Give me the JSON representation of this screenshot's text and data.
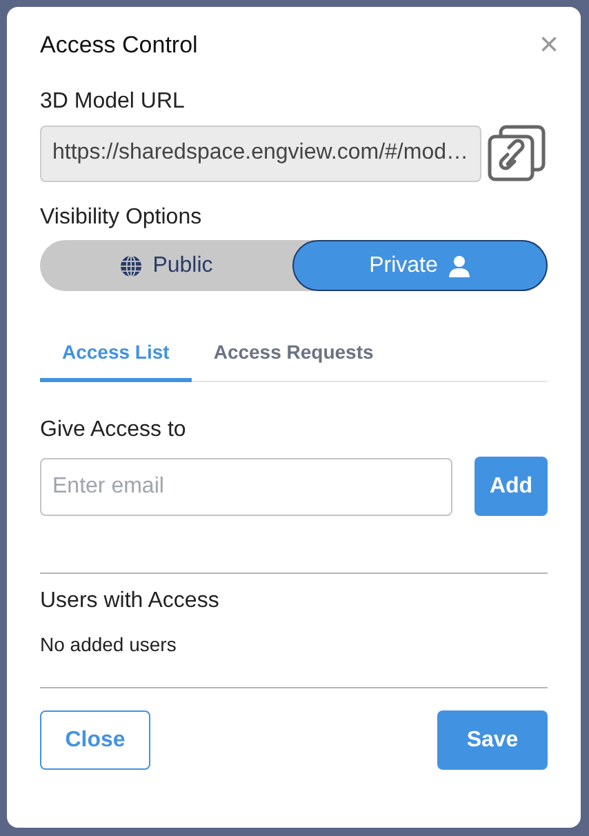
{
  "dialog": {
    "title": "Access Control",
    "close_icon": "×"
  },
  "url_field": {
    "label": "3D Model URL",
    "value": "https://sharedspace.engview.com/#/mod…"
  },
  "visibility": {
    "label": "Visibility Options",
    "options": [
      {
        "label": "Public",
        "kind": "public",
        "selected": false
      },
      {
        "label": "Private",
        "kind": "private",
        "selected": true
      }
    ]
  },
  "tabs": [
    {
      "label": "Access List",
      "selected": true
    },
    {
      "label": "Access Requests",
      "selected": false
    }
  ],
  "give_access": {
    "label": "Give Access to",
    "placeholder": "Enter email",
    "button": "Add"
  },
  "users": {
    "label": "Users with Access",
    "empty_text": "No added users"
  },
  "buttons": [
    {
      "label": "Close",
      "kind": "outline"
    },
    {
      "label": "Save",
      "kind": "primary"
    }
  ]
}
